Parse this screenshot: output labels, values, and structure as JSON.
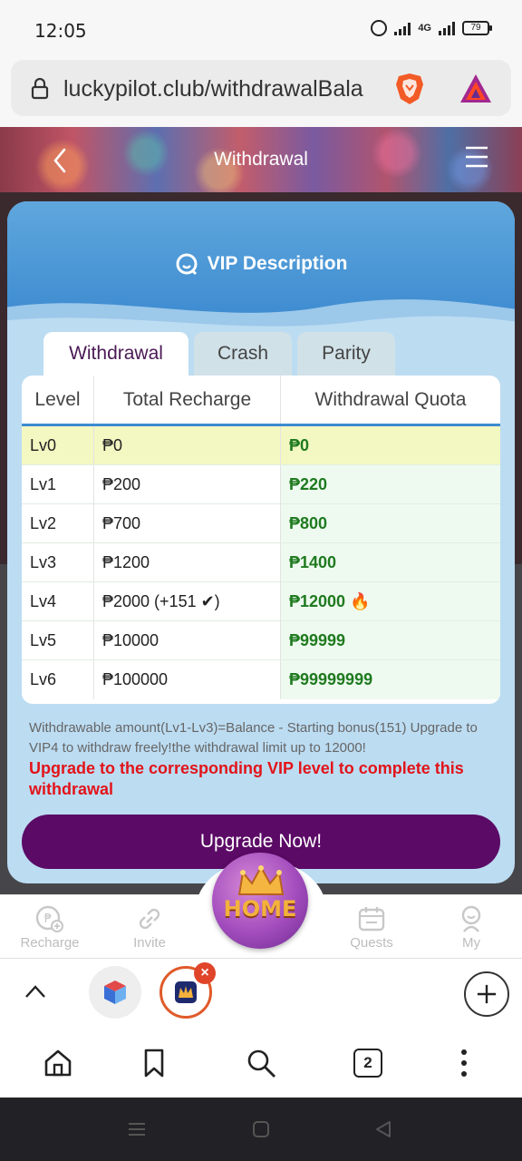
{
  "status": {
    "time": "12:05",
    "network": "4G",
    "battery": "79"
  },
  "browser": {
    "url": "luckypilot.club/withdrawalBala",
    "tab_count": "2"
  },
  "page": {
    "title": "Withdrawal"
  },
  "modal": {
    "title": "VIP Description",
    "tabs": [
      "Withdrawal",
      "Crash",
      "Parity"
    ],
    "table": {
      "headers": [
        "Level",
        "Total Recharge",
        "Withdrawal Quota"
      ],
      "rows": [
        {
          "level": "Lv0",
          "recharge": "₱0",
          "quota": "₱0"
        },
        {
          "level": "Lv1",
          "recharge": "₱200",
          "quota": "₱220"
        },
        {
          "level": "Lv2",
          "recharge": "₱700",
          "quota": "₱800"
        },
        {
          "level": "Lv3",
          "recharge": "₱1200",
          "quota": "₱1400"
        },
        {
          "level": "Lv4",
          "recharge": "₱2000 (+151 ✔)",
          "quota": "₱12000 🔥"
        },
        {
          "level": "Lv5",
          "recharge": "₱10000",
          "quota": "₱99999"
        },
        {
          "level": "Lv6",
          "recharge": "₱100000",
          "quota": "₱99999999"
        }
      ]
    },
    "note": "Withdrawable amount(Lv1-Lv3)=Balance - Starting bonus(151) Upgrade to VIP4 to withdraw freely!the withdrawal limit up to 12000!",
    "warning": "Upgrade to the corresponding VIP level to complete this withdrawal",
    "button": "Upgrade Now!"
  },
  "app_nav": {
    "items": [
      "Recharge",
      "Invite",
      "Quests",
      "My"
    ],
    "home_label": "HOME"
  },
  "colors": {
    "accent_purple": "#5b0a66",
    "header_blue": "#3d8bd0",
    "quota_green": "#1f7a1f",
    "warning_red": "#e2141a"
  }
}
